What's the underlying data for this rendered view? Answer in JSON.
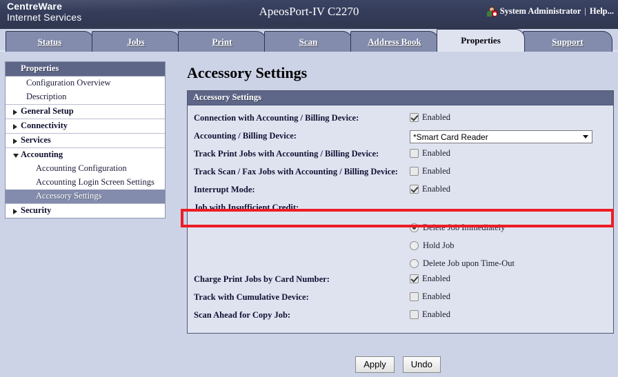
{
  "header": {
    "brand_line1": "CentreWare",
    "brand_line2": "Internet Services",
    "model": "ApeosPort-IV C2270",
    "user": "System Administrator",
    "separator": "|",
    "help": "Help..."
  },
  "tabs": [
    {
      "label": "Status",
      "active": false
    },
    {
      "label": "Jobs",
      "active": false
    },
    {
      "label": "Print",
      "active": false
    },
    {
      "label": "Scan",
      "active": false
    },
    {
      "label": "Address Book",
      "active": false
    },
    {
      "label": "Properties",
      "active": true
    },
    {
      "label": "Support",
      "active": false
    }
  ],
  "sidebar": {
    "title": "Properties",
    "items": [
      {
        "label": "Configuration Overview",
        "type": "leaf"
      },
      {
        "label": "Description",
        "type": "leaf"
      },
      {
        "label": "General Setup",
        "type": "group",
        "expanded": false
      },
      {
        "label": "Connectivity",
        "type": "group",
        "expanded": false
      },
      {
        "label": "Services",
        "type": "group",
        "expanded": false
      },
      {
        "label": "Accounting",
        "type": "group",
        "expanded": true
      },
      {
        "label": "Accounting Configuration",
        "type": "sub",
        "selected": false
      },
      {
        "label": "Accounting Login Screen Settings",
        "type": "sub",
        "selected": false
      },
      {
        "label": "Accessory Settings",
        "type": "sub",
        "selected": true
      },
      {
        "label": "Security",
        "type": "group",
        "expanded": false
      }
    ]
  },
  "main": {
    "page_title": "Accessory Settings",
    "panel_title": "Accessory Settings",
    "rows": {
      "connection": {
        "label": "Connection with Accounting / Billing Device:",
        "checkbox_label": "Enabled",
        "checked": true
      },
      "device": {
        "label": "Accounting / Billing Device:",
        "selected_option": "*Smart Card Reader",
        "options": [
          "*Smart Card Reader"
        ]
      },
      "track_print": {
        "label": "Track Print Jobs with Accounting / Billing Device:",
        "checkbox_label": "Enabled",
        "checked": false,
        "highlighted": true
      },
      "track_scan_fax": {
        "label": "Track Scan / Fax Jobs with Accounting / Billing Device:",
        "checkbox_label": "Enabled",
        "checked": false
      },
      "interrupt_mode": {
        "label": "Interrupt Mode:",
        "checkbox_label": "Enabled",
        "checked": true
      },
      "insufficient_credit": {
        "label": "Job with Insufficient Credit:",
        "options": [
          {
            "label": "Delete Job Immediately",
            "selected": true
          },
          {
            "label": "Hold Job",
            "selected": false
          },
          {
            "label": "Delete Job upon Time-Out",
            "selected": false
          }
        ]
      },
      "charge_by_card": {
        "label": "Charge Print Jobs by Card Number:",
        "checkbox_label": "Enabled",
        "checked": true
      },
      "cumulative_device": {
        "label": "Track with Cumulative Device:",
        "checkbox_label": "Enabled",
        "checked": false
      },
      "scan_ahead": {
        "label": "Scan Ahead for Copy Job:",
        "checkbox_label": "Enabled",
        "checked": false
      }
    },
    "buttons": {
      "apply": "Apply",
      "undo": "Undo"
    }
  },
  "colors": {
    "header_dark": "#343c5a",
    "tab_inactive": "#838cad",
    "tab_active": "#dfe3f0",
    "panel_header": "#5e6688",
    "page_bg": "#ccd3e6",
    "highlight_red": "#ed1c24"
  }
}
